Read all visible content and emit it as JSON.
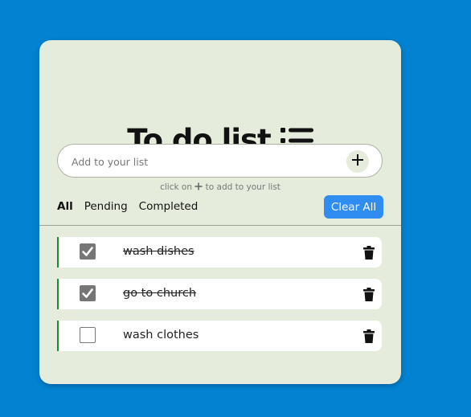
{
  "header": {
    "title": "To do list",
    "title_icon": "list-icon"
  },
  "input": {
    "placeholder": "Add to your list",
    "add_icon": "plus-icon"
  },
  "hint": {
    "prefix": "click on",
    "suffix": "to add to your list"
  },
  "filters": {
    "all": "All",
    "pending": "Pending",
    "completed": "Completed",
    "active": "All"
  },
  "clear_all_label": "Clear All",
  "tasks": [
    {
      "text": "wash dishes",
      "done": true
    },
    {
      "text": "go to church",
      "done": true
    },
    {
      "text": "wash clothes",
      "done": false
    }
  ],
  "colors": {
    "background": "#0282d0",
    "card": "#e5ecdc",
    "accent": "#2f8cf0",
    "task_border": "#1a8a2a"
  }
}
